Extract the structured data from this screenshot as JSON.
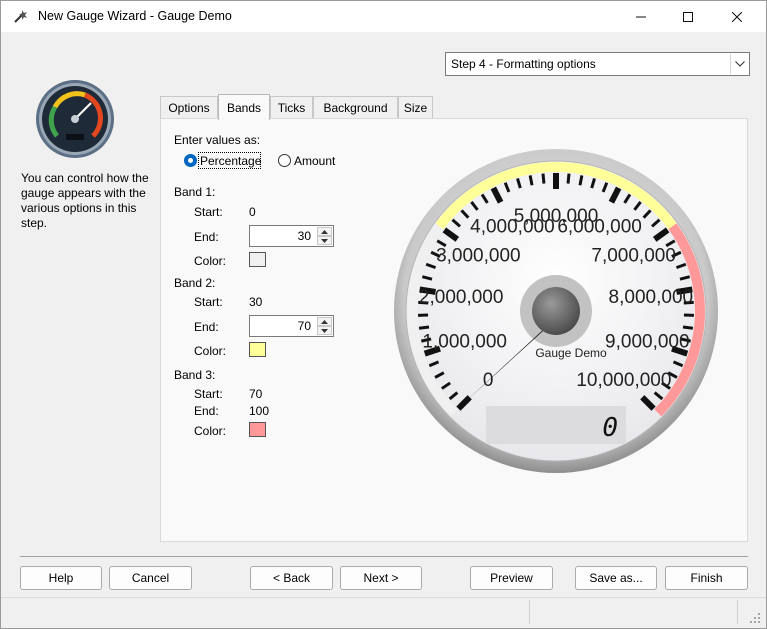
{
  "window": {
    "title": "New Gauge Wizard - Gauge Demo",
    "icon": "wizard-wand-icon"
  },
  "step_select": {
    "value": "Step 4 - Formatting options"
  },
  "side": {
    "description": "You can control how the gauge appears with the various options in this step."
  },
  "tabs": [
    "Options",
    "Bands",
    "Ticks",
    "Background",
    "Size"
  ],
  "active_tab": "Bands",
  "bands": {
    "enter_values_label": "Enter values as:",
    "mode_percentage": "Percentage",
    "mode_amount": "Amount",
    "selected_mode": "Percentage",
    "start_label": "Start:",
    "end_label": "End:",
    "color_label": "Color:",
    "band1": {
      "title": "Band 1:",
      "start": "0",
      "end": "30",
      "color": "#f0f0f0"
    },
    "band2": {
      "title": "Band 2:",
      "start": "30",
      "end": "70",
      "color": "#ffff99"
    },
    "band3": {
      "title": "Band 3:",
      "start": "70",
      "end": "100",
      "color": "#ff9999"
    }
  },
  "gauge_preview": {
    "title": "Gauge Demo",
    "readout": "0",
    "labels": [
      "0",
      "1,000,000",
      "2,000,000",
      "3,000,000",
      "4,000,000",
      "5,000,000",
      "6,000,000",
      "7,000,000",
      "8,000,000",
      "9,000,000",
      "10,000,000"
    ],
    "band_colors": {
      "low": "#f0f0f0",
      "mid": "#ffff99",
      "high": "#ff9999"
    }
  },
  "buttons": {
    "help": "Help",
    "cancel": "Cancel",
    "back": "< Back",
    "next": "Next >",
    "preview": "Preview",
    "save_as": "Save as...",
    "finish": "Finish"
  }
}
